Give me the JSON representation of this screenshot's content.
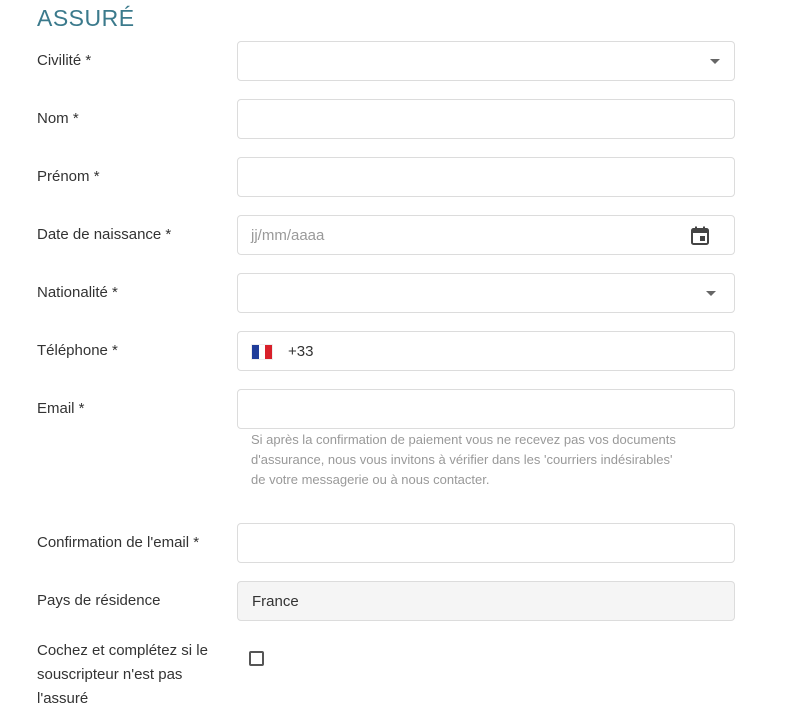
{
  "section": {
    "title": "ASSURÉ"
  },
  "fields": {
    "civilite": {
      "label": "Civilité *"
    },
    "nom": {
      "label": "Nom *"
    },
    "prenom": {
      "label": "Prénom *"
    },
    "naissance": {
      "label": "Date de naissance *",
      "placeholder": "jj/mm/aaaa"
    },
    "nationalite": {
      "label": "Nationalité *"
    },
    "telephone": {
      "label": "Téléphone *",
      "dial_code": "+33",
      "flag": "france-flag-icon"
    },
    "email": {
      "label": "Email *",
      "help_lines": [
        "Si après la confirmation de paiement vous ne recevez pas vos documents",
        "d'assurance, nous vous invitons à vérifier dans les 'courriers indésirables'",
        "de votre messagerie ou à nous contacter."
      ]
    },
    "email_confirm": {
      "label": "Confirmation de l'email *"
    },
    "pays": {
      "label": "Pays de résidence",
      "value": "France"
    },
    "souscripteur": {
      "label_lines": [
        "Cochez et complétez si le",
        "souscripteur n'est pas",
        "l'assuré"
      ],
      "checked": false
    }
  },
  "colors": {
    "title": "#3b7a8c",
    "border": "#dcdcdc",
    "help_text": "#999999",
    "disabled_bg": "#f5f5f5"
  }
}
